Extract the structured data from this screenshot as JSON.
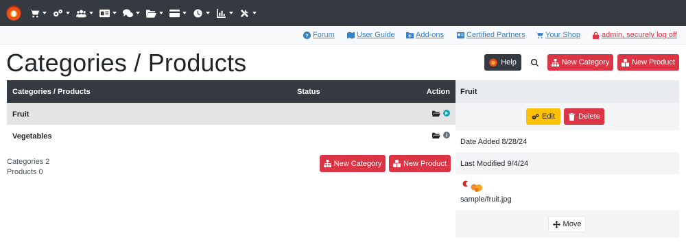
{
  "topnav": {
    "items": [
      {
        "icon": "cart-icon"
      },
      {
        "icon": "gears-icon"
      },
      {
        "icon": "users-icon"
      },
      {
        "icon": "id-card-icon"
      },
      {
        "icon": "comments-icon"
      },
      {
        "icon": "folder-open-icon"
      },
      {
        "icon": "credit-card-icon"
      },
      {
        "icon": "clock-icon"
      },
      {
        "icon": "chart-icon"
      },
      {
        "icon": "tools-icon"
      }
    ]
  },
  "subbar": {
    "forum": "Forum",
    "user_guide": "User Guide",
    "add_ons": "Add-ons",
    "certified_partners": "Certified Partners",
    "your_shop": "Your Shop",
    "logoff": "admin, securely log off"
  },
  "page": {
    "title": "Categories / Products"
  },
  "buttons": {
    "help": "Help",
    "new_category": "New Category",
    "new_product": "New Product"
  },
  "table": {
    "headers": {
      "name": "Categories / Products",
      "status": "Status",
      "action": "Action"
    },
    "rows": [
      {
        "name": "Fruit",
        "selected": true
      },
      {
        "name": "Vegetables",
        "selected": false
      }
    ]
  },
  "counts": {
    "categories": "Categories 2",
    "products": "Products 0"
  },
  "panel": {
    "title": "Fruit",
    "edit": "Edit",
    "delete": "Delete",
    "date_added": "Date Added 8/28/24",
    "last_modified": "Last Modified 9/4/24",
    "image_name": "sample/fruit.jpg",
    "move": "Move"
  },
  "colors": {
    "dark": "#343a40",
    "danger": "#dc3545",
    "warning": "#ffc107",
    "link": "#3b82c4",
    "info": "#17a2b8"
  }
}
